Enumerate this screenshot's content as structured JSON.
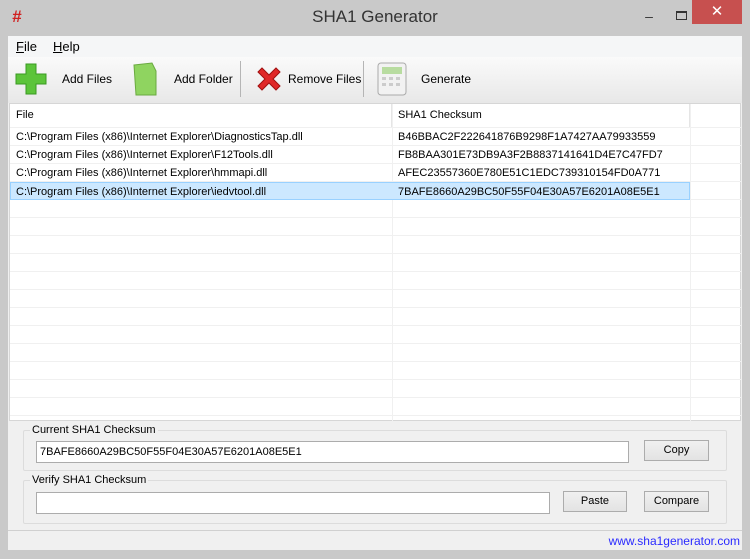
{
  "window": {
    "title": "SHA1 Generator",
    "app_icon": "#",
    "minimize": "–",
    "close": "✕"
  },
  "menu": [
    {
      "label": "File",
      "accel": "F",
      "rest": "ile"
    },
    {
      "label": "Help",
      "accel": "H",
      "rest": "elp"
    }
  ],
  "toolbar": {
    "add_files": "Add Files",
    "add_folder": "Add Folder",
    "remove_files": "Remove Files",
    "generate": "Generate"
  },
  "table": {
    "headers": [
      "File",
      "SHA1 Checksum"
    ],
    "rows": [
      {
        "file": "C:\\Program Files (x86)\\Internet Explorer\\DiagnosticsTap.dll",
        "sha1": "B46BBAC2F222641876B9298F1A7427AA79933559"
      },
      {
        "file": "C:\\Program Files (x86)\\Internet Explorer\\F12Tools.dll",
        "sha1": "FB8BAA301E73DB9A3F2B8837141641D4E7C47FD7"
      },
      {
        "file": "C:\\Program Files (x86)\\Internet Explorer\\hmmapi.dll",
        "sha1": "AFEC23557360E780E51C1EDC739310154FD0A771"
      },
      {
        "file": "C:\\Program Files (x86)\\Internet Explorer\\iedvtool.dll",
        "sha1": "7BAFE8660A29BC50F55F04E30A57E6201A08E5E1",
        "selected": true
      }
    ]
  },
  "current": {
    "label": "Current SHA1 Checksum",
    "value": "7BAFE8660A29BC50F55F04E30A57E6201A08E5E1",
    "copy": "Copy"
  },
  "verify": {
    "label": "Verify SHA1 Checksum",
    "value": "",
    "paste": "Paste",
    "compare": "Compare"
  },
  "status": {
    "link": "www.sha1generator.com"
  }
}
